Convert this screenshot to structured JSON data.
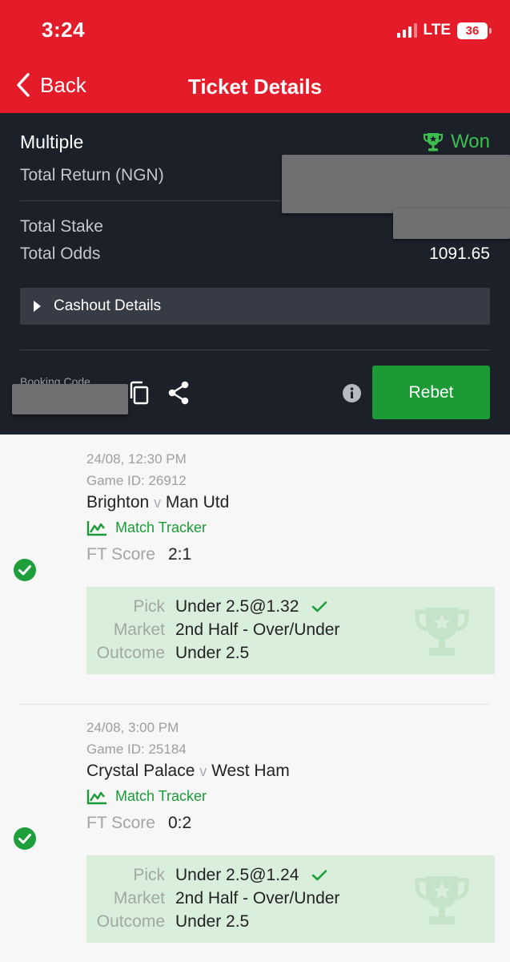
{
  "status_bar": {
    "time": "3:24",
    "network": "LTE",
    "battery": "36"
  },
  "nav": {
    "back_label": "Back",
    "title": "Ticket Details"
  },
  "summary": {
    "bet_type": "Multiple",
    "status": "Won",
    "total_return_label": "Total Return (NGN)",
    "total_stake_label": "Total Stake",
    "total_odds_label": "Total Odds",
    "total_odds_value": "1091.65",
    "cashout_label": "Cashout Details",
    "booking_code_label": "Booking Code",
    "rebet_label": "Rebet"
  },
  "selections": [
    {
      "date": "24/08, 12:30 PM",
      "game_id": "Game ID: 26912",
      "home": "Brighton",
      "vs": "v",
      "away": "Man Utd",
      "tracker_label": "Match Tracker",
      "score_label": "FT Score",
      "score": "2:1",
      "pick_label": "Pick",
      "pick": "Under 2.5@1.32",
      "market_label": "Market",
      "market": "2nd Half - Over/Under",
      "outcome_label": "Outcome",
      "outcome": "Under 2.5"
    },
    {
      "date": "24/08, 3:00 PM",
      "game_id": "Game ID: 25184",
      "home": "Crystal Palace",
      "vs": "v",
      "away": "West Ham",
      "tracker_label": "Match Tracker",
      "score_label": "FT Score",
      "score": "0:2",
      "pick_label": "Pick",
      "pick": "Under 2.5@1.24",
      "market_label": "Market",
      "market": "2nd Half - Over/Under",
      "outcome_label": "Outcome",
      "outcome": "Under 2.5"
    }
  ],
  "colors": {
    "brand_red": "#e41b28",
    "win_green": "#1b9a36",
    "dark_bg": "#1c2029",
    "pick_bg": "#d9eedb"
  }
}
